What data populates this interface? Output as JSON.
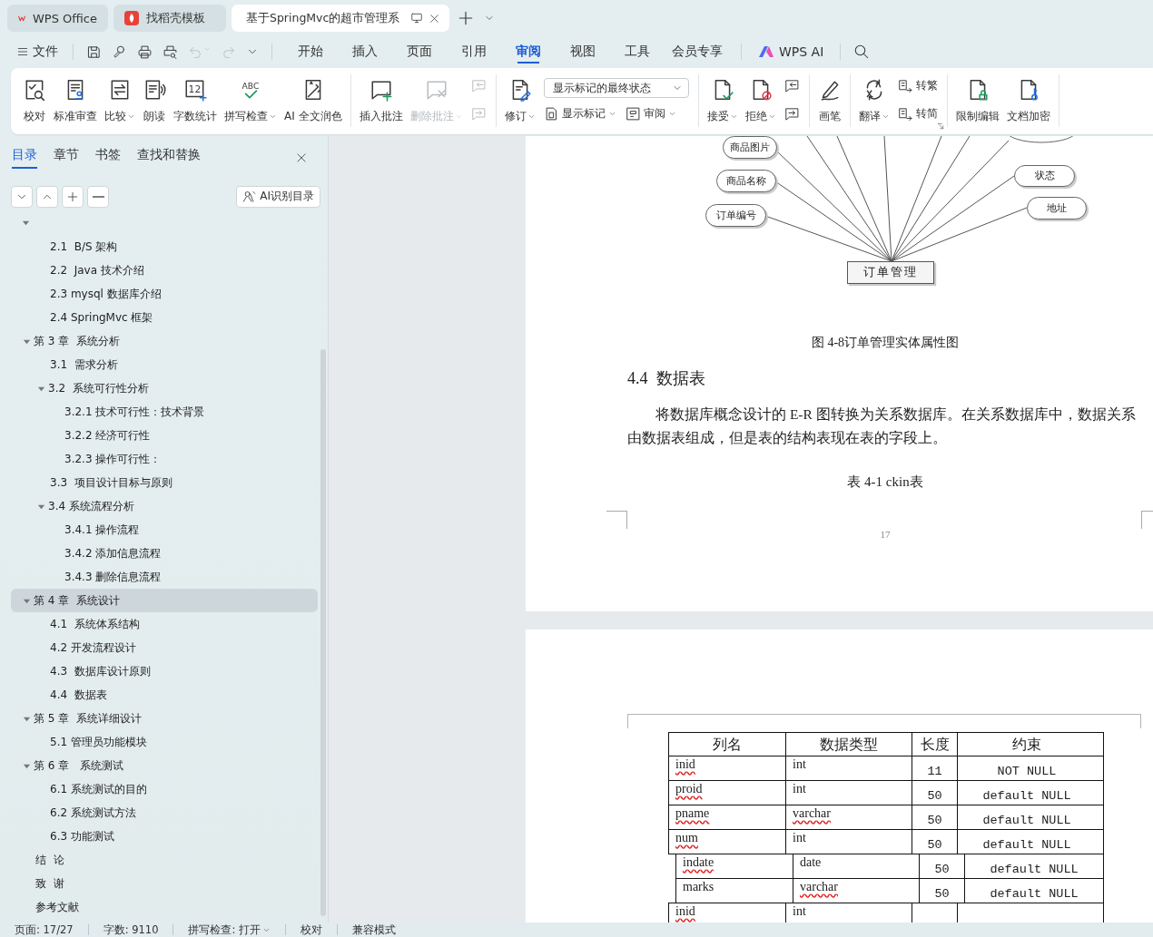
{
  "tabs": [
    {
      "label": "WPS Office",
      "kind": "home",
      "selected": false
    },
    {
      "label": "找稻壳模板",
      "kind": "template",
      "selected": false
    },
    {
      "label": "基于SpringMvc的超市管理系",
      "kind": "document",
      "selected": true
    }
  ],
  "menu": {
    "file": "文件",
    "tabs": [
      {
        "label": "开始",
        "selected": false
      },
      {
        "label": "插入",
        "selected": false
      },
      {
        "label": "页面",
        "selected": false
      },
      {
        "label": "引用",
        "selected": false
      },
      {
        "label": "审阅",
        "selected": true
      },
      {
        "label": "视图",
        "selected": false
      },
      {
        "label": "工具",
        "selected": false
      },
      {
        "label": "会员专享",
        "selected": false
      }
    ],
    "ai_label": "WPS AI"
  },
  "ribbon": {
    "groups": [
      {
        "items": [
          {
            "kind": "large",
            "label": "校对",
            "disabled": false
          },
          {
            "kind": "large",
            "label": "标准审查",
            "disabled": false
          },
          {
            "kind": "large",
            "label": "比较",
            "dropdown": true,
            "disabled": false
          },
          {
            "kind": "large",
            "label": "朗读",
            "disabled": false
          },
          {
            "kind": "large",
            "label": "字数统计",
            "disabled": false,
            "icon_text": "12"
          },
          {
            "kind": "large",
            "label": "拼写检查",
            "dropdown": true,
            "disabled": false,
            "icon_text": "ABC"
          },
          {
            "kind": "large",
            "label": "AI 全文润色",
            "disabled": false
          }
        ]
      },
      {
        "items": [
          {
            "kind": "large",
            "label": "插入批注",
            "disabled": false
          },
          {
            "kind": "large",
            "label": "删除批注",
            "dropdown": true,
            "disabled": true
          },
          {
            "kind": "stack",
            "rows": [
              [
                {
                  "kind": "small",
                  "disabled": true
                }
              ],
              [
                {
                  "kind": "small",
                  "disabled": true
                }
              ]
            ]
          }
        ]
      },
      {
        "items": [
          {
            "kind": "large",
            "label": "修订",
            "dropdown": true,
            "disabled": false
          },
          {
            "kind": "stack",
            "rows": [
              [
                {
                  "kind": "select",
                  "value": "显示标记的最终状态"
                }
              ],
              [
                {
                  "kind": "small",
                  "label": "显示标记",
                  "dropdown": true,
                  "disabled": false
                },
                {
                  "kind": "small",
                  "label": "审阅",
                  "dropdown": true,
                  "disabled": false
                }
              ]
            ]
          }
        ]
      },
      {
        "items": [
          {
            "kind": "large",
            "label": "接受",
            "dropdown": true,
            "disabled": false
          },
          {
            "kind": "large",
            "label": "拒绝",
            "dropdown": true,
            "disabled": false
          },
          {
            "kind": "stack",
            "rows": [
              [
                {
                  "kind": "small",
                  "disabled": false
                }
              ],
              [
                {
                  "kind": "small",
                  "disabled": false
                }
              ]
            ]
          }
        ]
      },
      {
        "items": [
          {
            "kind": "large",
            "label": "画笔",
            "disabled": false
          }
        ]
      },
      {
        "launcher": true,
        "items": [
          {
            "kind": "large",
            "label": "翻译",
            "dropdown": true,
            "disabled": false
          },
          {
            "kind": "stack",
            "rows": [
              [
                {
                  "kind": "small",
                  "label": "转繁",
                  "disabled": false
                }
              ],
              [
                {
                  "kind": "small",
                  "label": "转简",
                  "disabled": false
                }
              ]
            ]
          }
        ]
      },
      {
        "items": [
          {
            "kind": "large",
            "label": "限制编辑",
            "disabled": false
          },
          {
            "kind": "large",
            "label": "文档加密",
            "disabled": false
          }
        ]
      }
    ]
  },
  "sidebar": {
    "tabs": [
      {
        "label": "目录",
        "selected": true
      },
      {
        "label": "章节",
        "selected": false
      },
      {
        "label": "书签",
        "selected": false
      },
      {
        "label": "查找和替换",
        "selected": false
      }
    ],
    "ai_button": "AI识别目录",
    "outline": [
      {
        "expanded": true,
        "children": [
          {
            "label": "2.1  B/S 架构",
            "selected": false
          },
          {
            "label": "2.2  Java 技术介绍",
            "selected": false
          },
          {
            "label": "2.3 mysql 数据库介绍",
            "selected": false
          },
          {
            "label": "2.4 SpringMvc 框架",
            "selected": false
          }
        ]
      },
      {
        "label": "第 3 章  系统分析",
        "expanded": true,
        "selected": false,
        "children": [
          {
            "label": "3.1  需求分析",
            "selected": false
          },
          {
            "label": "3.2  系统可行性分析",
            "expanded": true,
            "selected": false,
            "children": [
              {
                "label": "3.2.1 技术可行性：技术背景",
                "selected": false
              },
              {
                "label": "3.2.2 经济可行性",
                "selected": false
              },
              {
                "label": "3.2.3 操作可行性：",
                "selected": false
              }
            ]
          },
          {
            "label": "3.3  项目设计目标与原则",
            "selected": false
          },
          {
            "label": "3.4 系统流程分析",
            "expanded": true,
            "selected": false,
            "children": [
              {
                "label": "3.4.1 操作流程",
                "selected": false
              },
              {
                "label": "3.4.2 添加信息流程",
                "selected": false
              },
              {
                "label": "3.4.3 删除信息流程",
                "selected": false
              }
            ]
          }
        ]
      },
      {
        "label": "第 4 章  系统设计",
        "expanded": true,
        "selected": true,
        "children": [
          {
            "label": "4.1  系统体系结构",
            "selected": false
          },
          {
            "label": "4.2 开发流程设计",
            "selected": false
          },
          {
            "label": "4.3  数据库设计原则",
            "selected": false
          },
          {
            "label": "4.4  数据表",
            "selected": false
          }
        ]
      },
      {
        "label": "第 5 章  系统详细设计",
        "expanded": true,
        "selected": false,
        "children": [
          {
            "label": "5.1 管理员功能模块",
            "selected": false
          }
        ]
      },
      {
        "label": "第 6 章   系统测试",
        "expanded": true,
        "selected": false,
        "children": [
          {
            "label": "6.1 系统测试的目的",
            "selected": false
          },
          {
            "label": "6.2 系统测试方法",
            "selected": false
          },
          {
            "label": "6.3 功能测试",
            "selected": false
          }
        ]
      },
      {
        "label": "结  论",
        "selected": false
      },
      {
        "label": "致  谢",
        "selected": false
      },
      {
        "label": "参考文献",
        "selected": false
      }
    ]
  },
  "document": {
    "figure": {
      "attributes": [
        "商品图片",
        "商品名称",
        "订单编号",
        "状态",
        "地址"
      ],
      "entity": "订单管理",
      "caption": "图 4-8订单管理实体属性图"
    },
    "heading": "4.4  数据表",
    "paragraph": "将数据库概念设计的 E-R 图转换为关系数据库。在关系数据库中，数据关系由数据表组成，但是表的结构表现在表的字段上。",
    "table_caption": "表 4-1 ckin表",
    "page_number": "17",
    "table": {
      "columns": [
        "列名",
        "数据类型",
        "长度",
        "约束"
      ],
      "rows": [
        {
          "shifted": false,
          "cells": [
            {
              "text": "inid",
              "misspelled": true
            },
            {
              "text": "int",
              "misspelled": false
            },
            {
              "text": "11",
              "misspelled": false
            },
            {
              "text": "NOT NULL",
              "misspelled": false
            }
          ]
        },
        {
          "shifted": false,
          "cells": [
            {
              "text": "proid",
              "misspelled": true
            },
            {
              "text": "int",
              "misspelled": false
            },
            {
              "text": "50",
              "misspelled": false
            },
            {
              "text": "default NULL",
              "misspelled": false
            }
          ]
        },
        {
          "shifted": false,
          "cells": [
            {
              "text": "pname",
              "misspelled": true
            },
            {
              "text": "varchar",
              "misspelled": true
            },
            {
              "text": "50",
              "misspelled": false
            },
            {
              "text": "default NULL",
              "misspelled": false
            }
          ]
        },
        {
          "shifted": false,
          "cells": [
            {
              "text": "num",
              "misspelled": true
            },
            {
              "text": "int",
              "misspelled": false
            },
            {
              "text": "50",
              "misspelled": false
            },
            {
              "text": "default NULL",
              "misspelled": false
            }
          ]
        },
        {
          "shifted": true,
          "cells": [
            {
              "text": "indate",
              "misspelled": true
            },
            {
              "text": "date",
              "misspelled": false
            },
            {
              "text": "50",
              "misspelled": false
            },
            {
              "text": "default NULL",
              "misspelled": false
            }
          ]
        },
        {
          "shifted": true,
          "cells": [
            {
              "text": "marks",
              "misspelled": false
            },
            {
              "text": "varchar",
              "misspelled": true
            },
            {
              "text": "50",
              "misspelled": false
            },
            {
              "text": "default NULL",
              "misspelled": false
            }
          ]
        },
        {
          "shifted": false,
          "cells": [
            {
              "text": "inid",
              "misspelled": true
            },
            {
              "text": "int",
              "misspelled": false
            }
          ]
        }
      ]
    }
  },
  "status_bar": [
    {
      "label": "页面: 17/27"
    },
    {
      "label": "字数: 9110"
    },
    {
      "label": "拼写检查: 打开",
      "dropdown": true
    },
    {
      "label": "校对"
    },
    {
      "label": "兼容模式"
    }
  ]
}
